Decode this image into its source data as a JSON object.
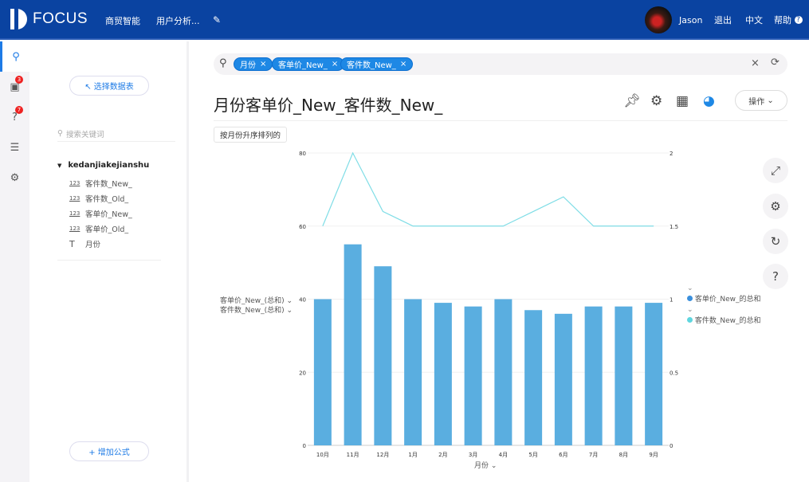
{
  "header": {
    "brand": "FOCUS",
    "nav": [
      "商贸智能",
      "用户分析..."
    ],
    "user": "Jason",
    "logout": "退出",
    "language": "中文",
    "help": "帮助"
  },
  "rail": {
    "badges": {
      "board": "3",
      "help": "7"
    }
  },
  "sidebar": {
    "select_table": "↖ 选择数据表",
    "search_placeholder": "搜索关键词",
    "table_name": "kedanjiakejianshu",
    "columns": [
      {
        "type": "123",
        "label": "客件数_New_"
      },
      {
        "type": "123",
        "label": "客件数_Old_"
      },
      {
        "type": "123",
        "label": "客单价_New_"
      },
      {
        "type": "123",
        "label": "客单价_Old_"
      },
      {
        "type": "T",
        "label": "月份"
      }
    ],
    "add_formula": "+ 增加公式"
  },
  "search": {
    "tags": [
      "月份",
      "客单价_New_",
      "客件数_New_"
    ]
  },
  "main": {
    "title": "月份客单价_New_客件数_New_",
    "ops": "操作",
    "sort_label": "按月份升序排列的"
  },
  "colors": {
    "header": "#0a43a1",
    "accent": "#1e88e5",
    "bar": "#5aaee0",
    "line": "#7fdde6"
  },
  "chart_data": {
    "type": "bar+line",
    "categories": [
      "10月",
      "11月",
      "12月",
      "1月",
      "2月",
      "3月",
      "4月",
      "5月",
      "6月",
      "7月",
      "8月",
      "9月"
    ],
    "xlabel": "月份",
    "y_left": {
      "labels": [
        "客单价_New_(总和)",
        "客件数_New_(总和)"
      ],
      "ticks": [
        0,
        20,
        40,
        60,
        80
      ],
      "range": [
        0,
        80
      ]
    },
    "y_right": {
      "ticks": [
        "0",
        "0.5",
        "1",
        "1.5",
        "2"
      ],
      "range": [
        0,
        2
      ]
    },
    "series": [
      {
        "name": "客单价_New_的总和",
        "type": "bar",
        "axis": "left",
        "color": "#5aaee0",
        "values": [
          40,
          55,
          49,
          40,
          39,
          38,
          40,
          37,
          36,
          38,
          38,
          39
        ]
      },
      {
        "name": "客件数_New_的总和",
        "type": "line",
        "axis": "right",
        "color": "#7fdde6",
        "values": [
          1.5,
          2,
          1.6,
          1.5,
          1.5,
          1.5,
          1.5,
          1.6,
          1.7,
          1.5,
          1.5,
          1.5
        ]
      }
    ],
    "grid": true,
    "legend": "right"
  }
}
